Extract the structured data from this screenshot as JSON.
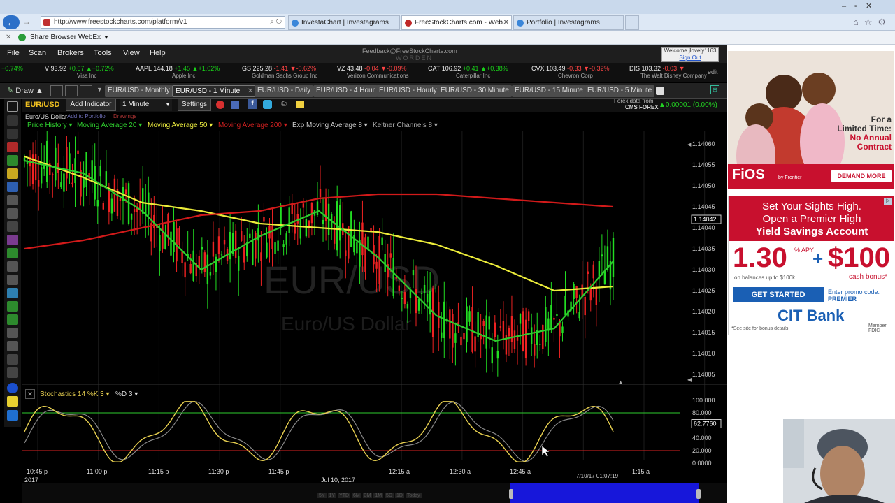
{
  "browser": {
    "url": "http://www.freestockcharts.com/platform/v1",
    "tabs": [
      {
        "label": "InvestaChart | Investagrams",
        "active": false
      },
      {
        "label": "FreeStockCharts.com - Web...",
        "active": true
      },
      {
        "label": "Portfolio | Investagrams",
        "active": false
      }
    ],
    "favorites": [
      "Share Browser",
      "WebEx"
    ]
  },
  "app": {
    "menu": [
      "File",
      "Scan",
      "Brokers",
      "Tools",
      "View",
      "Help"
    ],
    "feedback": "Feedback@FreeStockCharts.com",
    "brand": "WORDEN",
    "welcome": "Welcome jlovely1163",
    "signout": "Sign Out",
    "edit": "edit"
  },
  "ticker": [
    {
      "sym": "",
      "price": "",
      "chg": "+0.74%",
      "dir": "up",
      "name": ""
    },
    {
      "sym": "V",
      "price": "93.92",
      "chg": "+0.67",
      "pct": "+0.72%",
      "dir": "up",
      "name": "Visa Inc"
    },
    {
      "sym": "AAPL",
      "price": "144.18",
      "chg": "+1.45",
      "pct": "+1.02%",
      "dir": "up",
      "name": "Apple Inc"
    },
    {
      "sym": "GS",
      "price": "225.28",
      "chg": "-1.41",
      "pct": "-0.62%",
      "dir": "dn",
      "name": "Goldman Sachs Group Inc"
    },
    {
      "sym": "VZ",
      "price": "43.48",
      "chg": "-0.04",
      "pct": "-0.09%",
      "dir": "dn",
      "name": "Verizon Communications"
    },
    {
      "sym": "CAT",
      "price": "106.92",
      "chg": "+0.41",
      "pct": "+0.38%",
      "dir": "up",
      "name": "Caterpillar Inc"
    },
    {
      "sym": "CVX",
      "price": "103.49",
      "chg": "-0.33",
      "pct": "-0.32%",
      "dir": "dn",
      "name": "Chevron Corp"
    },
    {
      "sym": "DIS",
      "price": "103.32",
      "chg": "-0.03",
      "pct": "",
      "dir": "dn",
      "name": "The Walt Disney Company"
    }
  ],
  "chart_tabs": [
    {
      "label": "EUR/USD - Monthly",
      "sel": false
    },
    {
      "label": "EUR/USD - 1 Minute",
      "sel": true
    },
    {
      "label": "EUR/USD - Daily",
      "sel": false
    },
    {
      "label": "EUR/USD - 4 Hour",
      "sel": false
    },
    {
      "label": "EUR/USD - Hourly",
      "sel": false
    },
    {
      "label": "EUR/USD - 30 Minute",
      "sel": false
    },
    {
      "label": "EUR/USD - 15 Minute",
      "sel": false
    },
    {
      "label": "EUR/USD - 5 Minute",
      "sel": false
    }
  ],
  "draw_label": "Draw",
  "controls": {
    "symbol": "EUR/USD",
    "add_indicator": "Add Indicator",
    "interval": "1 Minute",
    "settings": "Settings",
    "source": "Forex data from",
    "source2": "CMS FOREX",
    "change": "0.00001 (0.00%)",
    "full_name": "Euro/US Dollar",
    "add_portfolio": "Add to Portfolio",
    "drawings": "Drawings"
  },
  "indicators": [
    {
      "label": "Price History",
      "color": "#2fd12f"
    },
    {
      "label": "Moving Average 20",
      "color": "#2fd12f"
    },
    {
      "label": "Moving Average 50",
      "color": "#f0f040"
    },
    {
      "label": "Moving Average 200",
      "color": "#d02020"
    },
    {
      "label": "Exp Moving Average 8",
      "color": "#cccccc"
    },
    {
      "label": "Keltner Channels 8",
      "color": "#aaaaaa"
    }
  ],
  "watermark": {
    "symbol": "EUR/USD",
    "name": "Euro/US Dollar"
  },
  "price_axis": [
    "1.14060",
    "1.14055",
    "1.14050",
    "1.14045",
    "1.14040",
    "1.14035",
    "1.14030",
    "1.14025",
    "1.14020",
    "1.14015",
    "1.14010",
    "1.14005"
  ],
  "current_price": "1.14042",
  "stochastics": {
    "label": "Stochastics 14 %K 3",
    "d_label": "%D 3",
    "axis": [
      "100.000",
      "80.000",
      "60.000",
      "40.000",
      "20.000",
      "0.0000"
    ],
    "current": "62.7760"
  },
  "time_axis": [
    "10:45 p",
    "11:00 p",
    "11:15 p",
    "11:30 p",
    "11:45 p",
    "12:15 a",
    "12:30 a",
    "12:45 a",
    "1:15 a"
  ],
  "year_label": "2017",
  "date_label": "Jul 10, 2017",
  "cursor_time": "7/10/17 01:07:19",
  "chart_data": {
    "type": "line",
    "title": "EUR/USD",
    "ylim": [
      1.14003,
      1.14063
    ],
    "series": [
      {
        "name": "Moving Average 50",
        "values": [
          1.14057,
          1.14052,
          1.14046,
          1.14044,
          1.14041,
          1.1404,
          1.14039,
          1.14036,
          1.14031,
          1.14025,
          1.14026
        ]
      },
      {
        "name": "Moving Average 200",
        "values": [
          1.14035,
          1.14037,
          1.1404,
          1.14043,
          1.14044,
          1.14047,
          1.14048,
          1.14048,
          1.14047,
          1.14046,
          1.14045
        ]
      },
      {
        "name": "Moving Average 20",
        "values": [
          1.14056,
          1.14053,
          1.14044,
          1.1403,
          1.14038,
          1.14044,
          1.14033,
          1.14019,
          1.14013,
          1.14016,
          1.14032
        ]
      }
    ]
  },
  "ads": {
    "fios": {
      "tag1": "For a",
      "tag2": "Limited Time:",
      "tag3": "No Annual",
      "tag4": "Contract",
      "brand": "FiOS",
      "by": "by Frontier",
      "cta": "DEMAND MORE"
    },
    "cit": {
      "h1": "Set Your Sights High.",
      "h2": "Open a Premier High",
      "h3": "Yield Savings Account",
      "rate": "1.30",
      "apy": "% APY",
      "plus": "+",
      "bonus": "$100",
      "bonus_sub": "cash bonus*",
      "note": "on balances up to $100k",
      "cta": "GET STARTED",
      "promo": "Enter promo code:",
      "code": "PREMIER",
      "brand": "CIT Bank",
      "fine": "*See site for bonus details.",
      "fdic": "Member FDIC"
    }
  },
  "scroll_buttons": [
    "5Y",
    "1Y",
    "YTD",
    "6M",
    "3M",
    "1M",
    "5D",
    "1D",
    "Today"
  ]
}
